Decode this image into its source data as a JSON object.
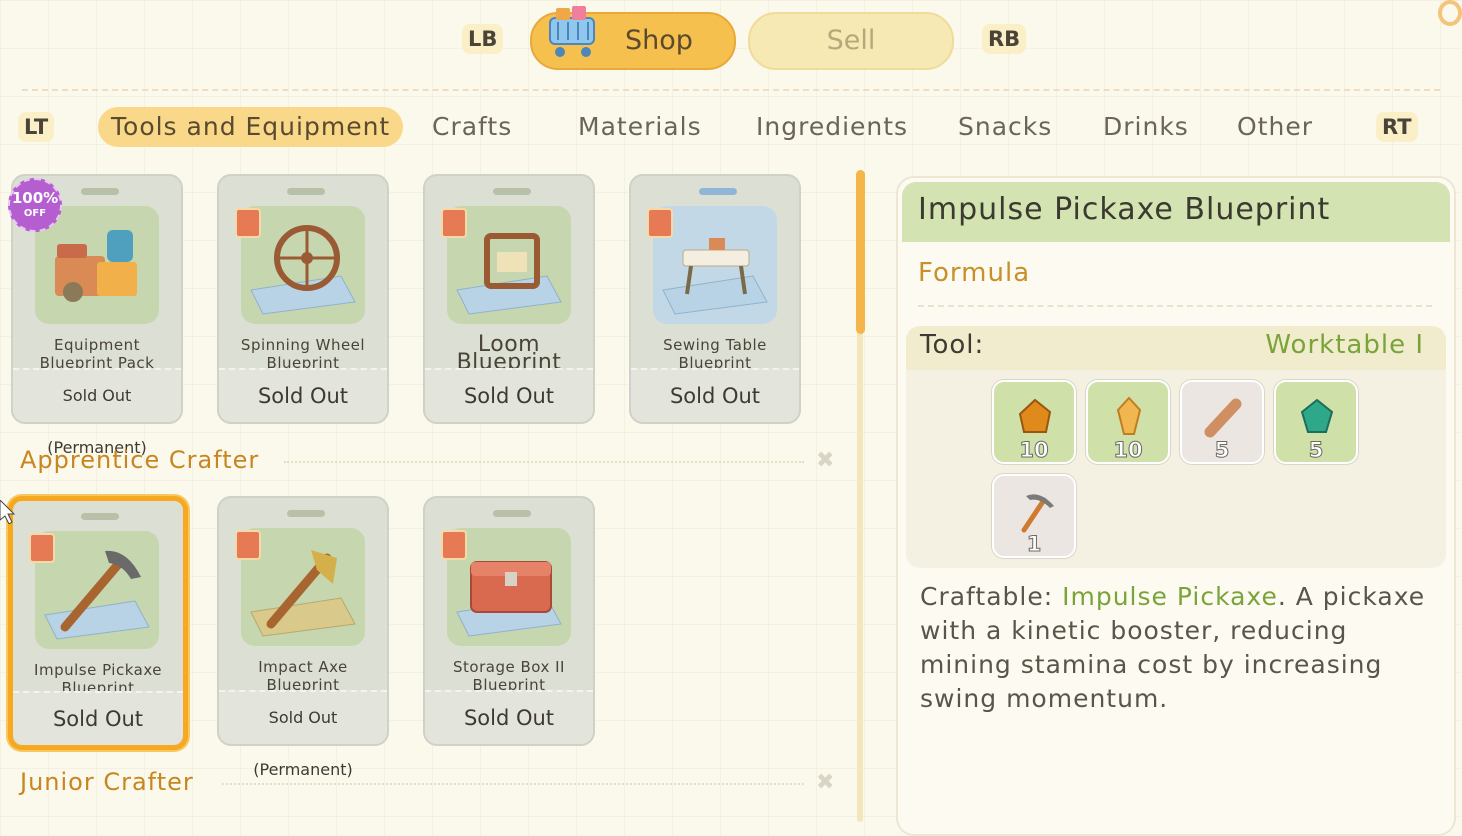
{
  "top_tabs": {
    "left_hint": "LB",
    "right_hint": "RB",
    "shop_label": "Shop",
    "sell_label": "Sell"
  },
  "categories": {
    "left_hint": "LT",
    "right_hint": "RT",
    "items": [
      "Tools and Equipment",
      "Crafts",
      "Materials",
      "Ingredients",
      "Snacks",
      "Drinks",
      "Other"
    ],
    "active": "Tools and Equipment"
  },
  "cards_row1": [
    {
      "name": "Equipment Blueprint Pack",
      "status": "Sold Out (Permanent)",
      "badge_pct": "100%",
      "badge_off": "OFF"
    },
    {
      "name": "Spinning Wheel Blueprint",
      "status": "Sold Out"
    },
    {
      "name": "Loom Blueprint",
      "status": "Sold Out"
    },
    {
      "name": "Sewing Table Blueprint",
      "status": "Sold Out"
    }
  ],
  "section1": {
    "title": "Apprentice Crafter"
  },
  "cards_row2": [
    {
      "name": "Impulse Pickaxe Blueprint",
      "status": "Sold Out"
    },
    {
      "name": "Impact Axe Blueprint",
      "status": "Sold Out (Permanent)"
    },
    {
      "name": "Storage Box II Blueprint",
      "status": "Sold Out"
    }
  ],
  "section2": {
    "title": "Junior Crafter"
  },
  "detail": {
    "title": "Impulse Pickaxe Blueprint",
    "subtitle": "Formula",
    "tool_label": "Tool:",
    "tool_value": "Worktable I",
    "materials": [
      {
        "icon": "copper-ore-icon",
        "qty": "10"
      },
      {
        "icon": "amber-gem-icon",
        "qty": "10"
      },
      {
        "icon": "wood-log-icon",
        "qty": "5"
      },
      {
        "icon": "green-gem-icon",
        "qty": "5"
      },
      {
        "icon": "pickaxe-icon",
        "qty": "1"
      }
    ],
    "desc_prefix": "Craftable: ",
    "desc_highlight": "Impulse Pickaxe",
    "desc_rest": ". A pickaxe with a kinetic booster, reducing mining stamina cost by increasing swing momentum."
  }
}
